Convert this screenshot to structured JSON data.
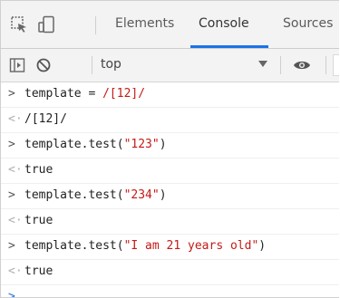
{
  "tabs": {
    "elements": "Elements",
    "console": "Console",
    "sources": "Sources"
  },
  "toolbar": {
    "context": "top"
  },
  "console": {
    "line1_input_a": "template = ",
    "line1_input_b": "/[12]/",
    "line2_output": "/[12]/",
    "line3_input_a": "template.test(",
    "line3_input_b": "\"123\"",
    "line3_input_c": ")",
    "line4_output": "true",
    "line5_input_a": "template.test(",
    "line5_input_b": "\"234\"",
    "line5_input_c": ")",
    "line6_output": "true",
    "line7_input_a": "template.test(",
    "line7_input_b": "\"I am 21 years old\"",
    "line7_input_c": ")",
    "line8_output": "true"
  },
  "colors": {
    "string": "#c41a16",
    "boolean": "#1a1aa6",
    "active_tab_underline": "#1a73e8",
    "prompt_cursor": "#1a73e8"
  },
  "icons": {
    "inspect": "cursor-select-icon",
    "device": "device-toggle-icon",
    "sidebar": "sidebar-toggle-icon",
    "clear": "clear-console-icon",
    "eye": "eye-icon"
  }
}
